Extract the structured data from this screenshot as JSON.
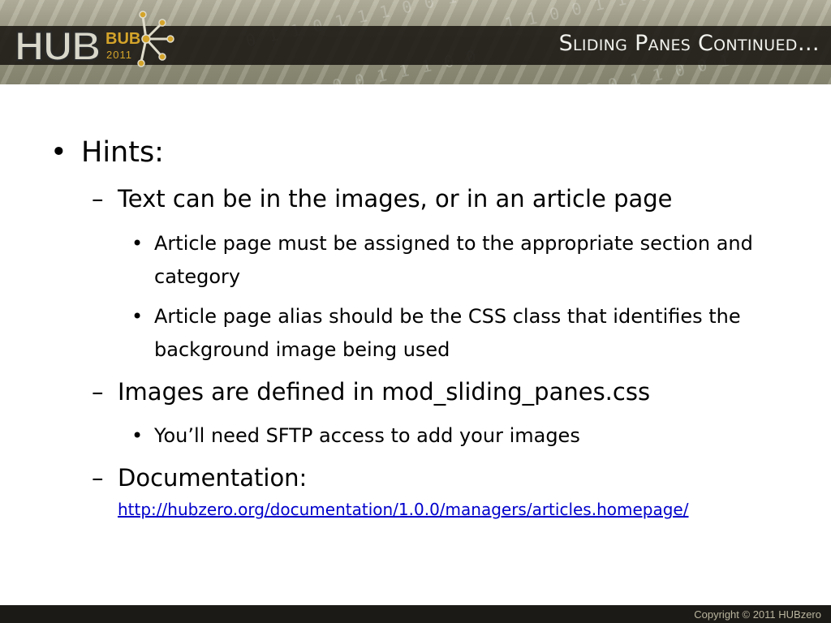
{
  "header": {
    "slide_title": "Sliding Panes Continued…",
    "logo": {
      "hub_text": "HUB",
      "bub_text": "BUB",
      "year_text": "2011"
    }
  },
  "body": {
    "l1": {
      "text": "Hints:"
    },
    "items": [
      {
        "text": "Text can be in the images, or in an article page",
        "sub": [
          "Article page must be assigned to the appropriate section and category",
          "Article page alias should be the CSS class that identifies the background image being used"
        ]
      },
      {
        "text": "Images are defined in mod_sliding_panes.css",
        "sub": [
          "You’ll need SFTP access to add your images"
        ]
      },
      {
        "text": "Documentation:",
        "link": "http://hubzero.org/documentation/1.0.0/managers/articles.homepage/"
      }
    ]
  },
  "footer": {
    "copyright": "Copyright  ©  2011  HUBzero"
  },
  "colors": {
    "title_bar": "#1e1b16",
    "link": "#0000cc",
    "logo_accent": "#d4a42a"
  }
}
